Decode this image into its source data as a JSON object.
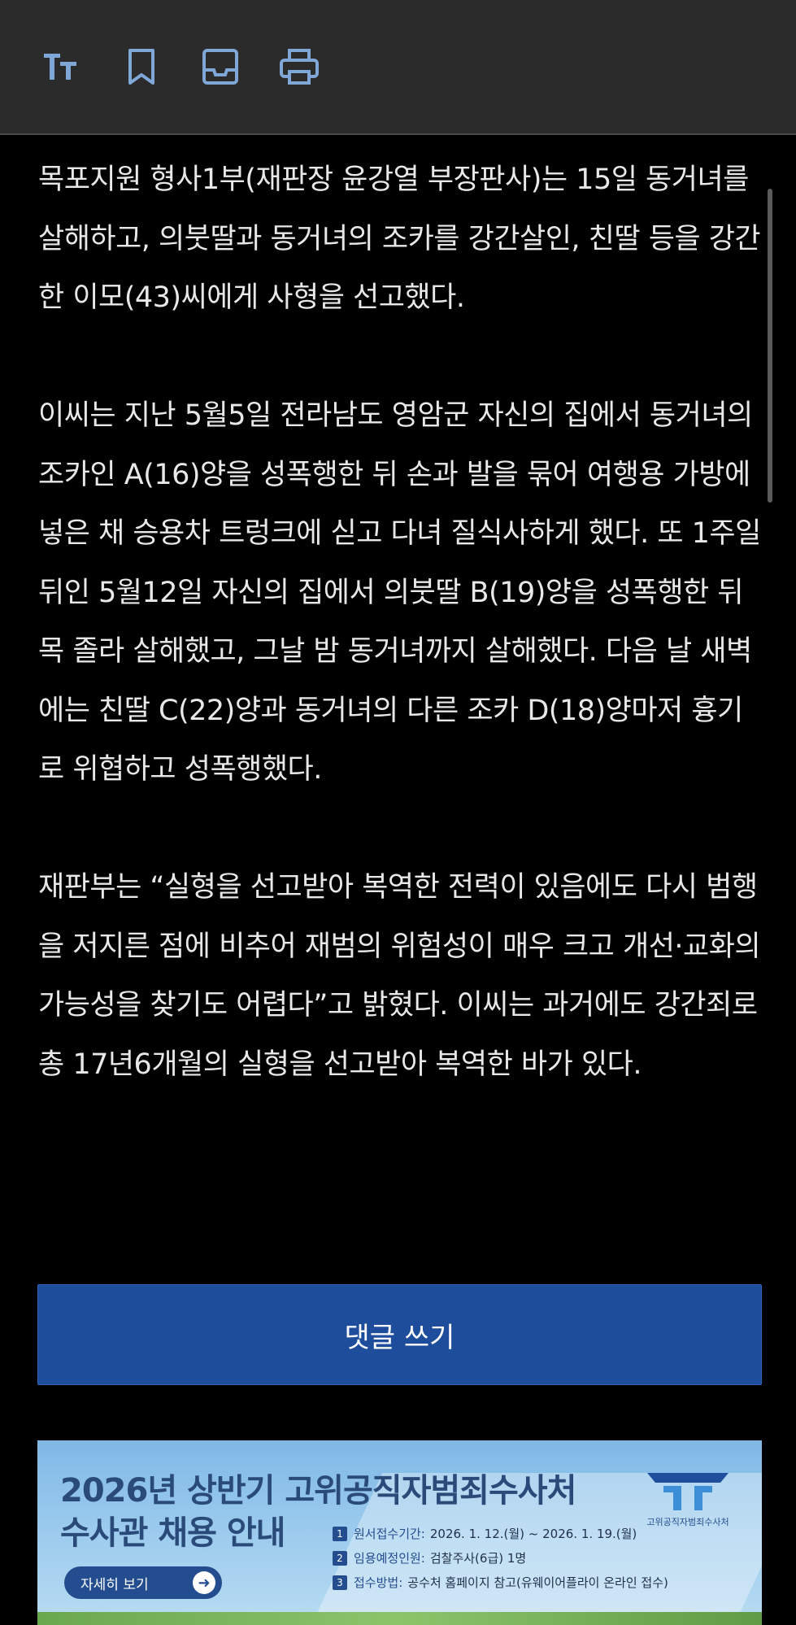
{
  "toolbar": {
    "icons": [
      "text-size-icon",
      "bookmark-icon",
      "inbox-icon",
      "print-icon"
    ],
    "icon_color": "#7fa8d8"
  },
  "article": {
    "paragraphs": [
      "목포지원 형사1부(재판장 윤강열 부장판사)는 15일 동거녀를 살해하고, 의붓딸과 동거녀의 조카를 강간살인, 친딸 등을 강간한 이모(43)씨에게 사형을 선고했다.",
      "이씨는 지난 5월5일 전라남도 영암군 자신의 집에서 동거녀의 조카인 A(16)양을 성폭행한 뒤 손과 발을 묶어 여행용 가방에 넣은 채 승용차 트렁크에 싣고 다녀 질식사하게 했다. 또 1주일 뒤인 5월12일 자신의 집에서 의붓딸 B(19)양을 성폭행한 뒤 목 졸라 살해했고, 그날 밤 동거녀까지 살해했다. 다음 날 새벽에는 친딸 C(22)양과 동거녀의 다른 조카 D(18)양마저 흉기로 위협하고 성폭행했다.",
      "재판부는 “실형을 선고받아 복역한 전력이 있음에도 다시 범행을 저지른 점에 비추어 재범의 위험성이 매우 크고 개선·교화의 가능성을 찾기도 어렵다”고 밝혔다. 이씨는 과거에도 강간죄로 총 17년6개월의 실형을 선고받아 복역한 바가 있다."
    ]
  },
  "comment_button": {
    "label": "댓글 쓰기",
    "color": "#1d4d9b"
  },
  "banner": {
    "title_line1": "2026년 상반기 고위공직자범죄수사처",
    "title_line2": "수사관 채용 안내",
    "more_label": "자세히 보기",
    "rows": [
      {
        "num": "1",
        "key": "원서접수기간:",
        "value": "2026. 1. 12.(월) ~ 2026. 1. 19.(월)"
      },
      {
        "num": "2",
        "key": "임용예정인원:",
        "value": "검찰주사(6급) 1명"
      },
      {
        "num": "3",
        "key": "접수방법:",
        "value": "공수처 홈페이지 참고(유웨이어플라이 온라인 접수)"
      }
    ],
    "logo_text": "고위공직자범죄수사처"
  }
}
